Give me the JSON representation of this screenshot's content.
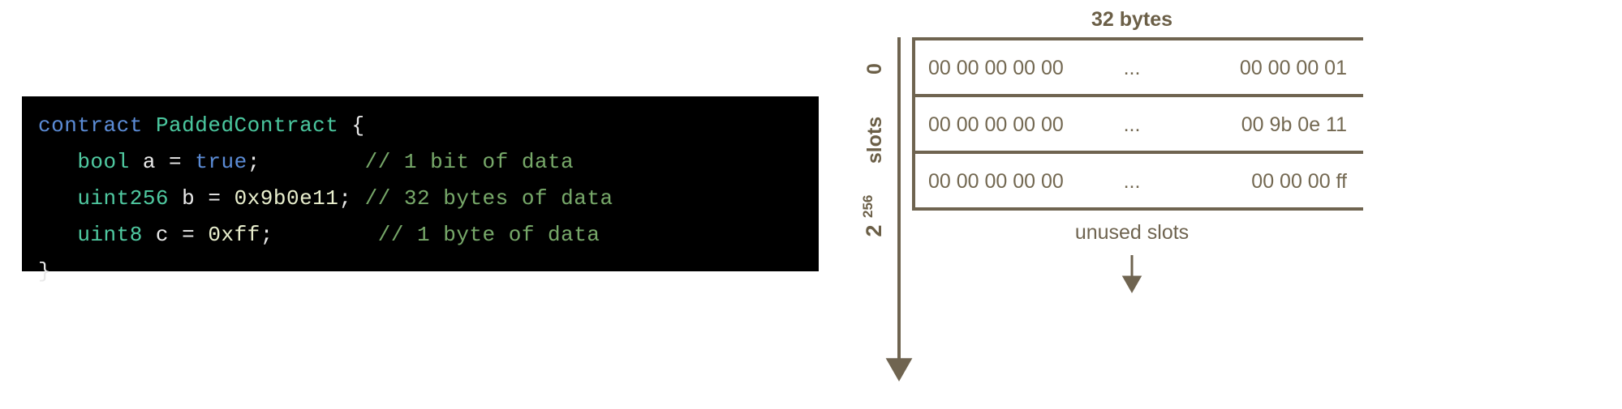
{
  "code_panel": {
    "background": "#000000",
    "lines": [
      {
        "id": "line1",
        "tokens": [
          {
            "t": "contract ",
            "c": "kw"
          },
          {
            "t": "PaddedContract",
            "c": "name"
          },
          {
            "t": " {",
            "c": "plain"
          }
        ]
      },
      {
        "id": "line2",
        "tokens": [
          {
            "t": "   ",
            "c": "plain"
          },
          {
            "t": "bool",
            "c": "type"
          },
          {
            "t": " a ",
            "c": "plain"
          },
          {
            "t": "= ",
            "c": "plain"
          },
          {
            "t": "true",
            "c": "kw"
          },
          {
            "t": ";        ",
            "c": "plain"
          },
          {
            "t": "// 1 bit of data",
            "c": "comment"
          }
        ]
      },
      {
        "id": "line3",
        "tokens": [
          {
            "t": "   ",
            "c": "plain"
          },
          {
            "t": "uint256",
            "c": "type"
          },
          {
            "t": " b ",
            "c": "plain"
          },
          {
            "t": "= ",
            "c": "plain"
          },
          {
            "t": "0x9b0e11",
            "c": "num"
          },
          {
            "t": "; ",
            "c": "plain"
          },
          {
            "t": "// 32 bytes of data",
            "c": "comment"
          }
        ]
      },
      {
        "id": "line4",
        "tokens": [
          {
            "t": "   ",
            "c": "plain"
          },
          {
            "t": "uint8",
            "c": "type"
          },
          {
            "t": " c ",
            "c": "plain"
          },
          {
            "t": "= ",
            "c": "plain"
          },
          {
            "t": "0xff",
            "c": "num"
          },
          {
            "t": ";        ",
            "c": "plain"
          },
          {
            "t": "// 1 byte of data",
            "c": "comment"
          }
        ]
      },
      {
        "id": "line5",
        "tokens": [
          {
            "t": "}",
            "c": "plain"
          }
        ]
      }
    ]
  },
  "diagram": {
    "accent_color": "#6f6450",
    "header_label": "32 bytes",
    "axis": {
      "top_label": "0",
      "middle_label": "slots",
      "bottom_label_base": "2",
      "bottom_label_exp": "256"
    },
    "rows": [
      {
        "left": "00 00 00 00 00",
        "middle": "...",
        "right": "00 00 00 01"
      },
      {
        "left": "00 00 00 00 00",
        "middle": "...",
        "right": "00 9b 0e 11"
      },
      {
        "left": "00 00 00 00 00",
        "middle": "...",
        "right": "00 00 00  ff"
      }
    ],
    "ellipsis_below": "...",
    "unused_label": "unused slots"
  }
}
